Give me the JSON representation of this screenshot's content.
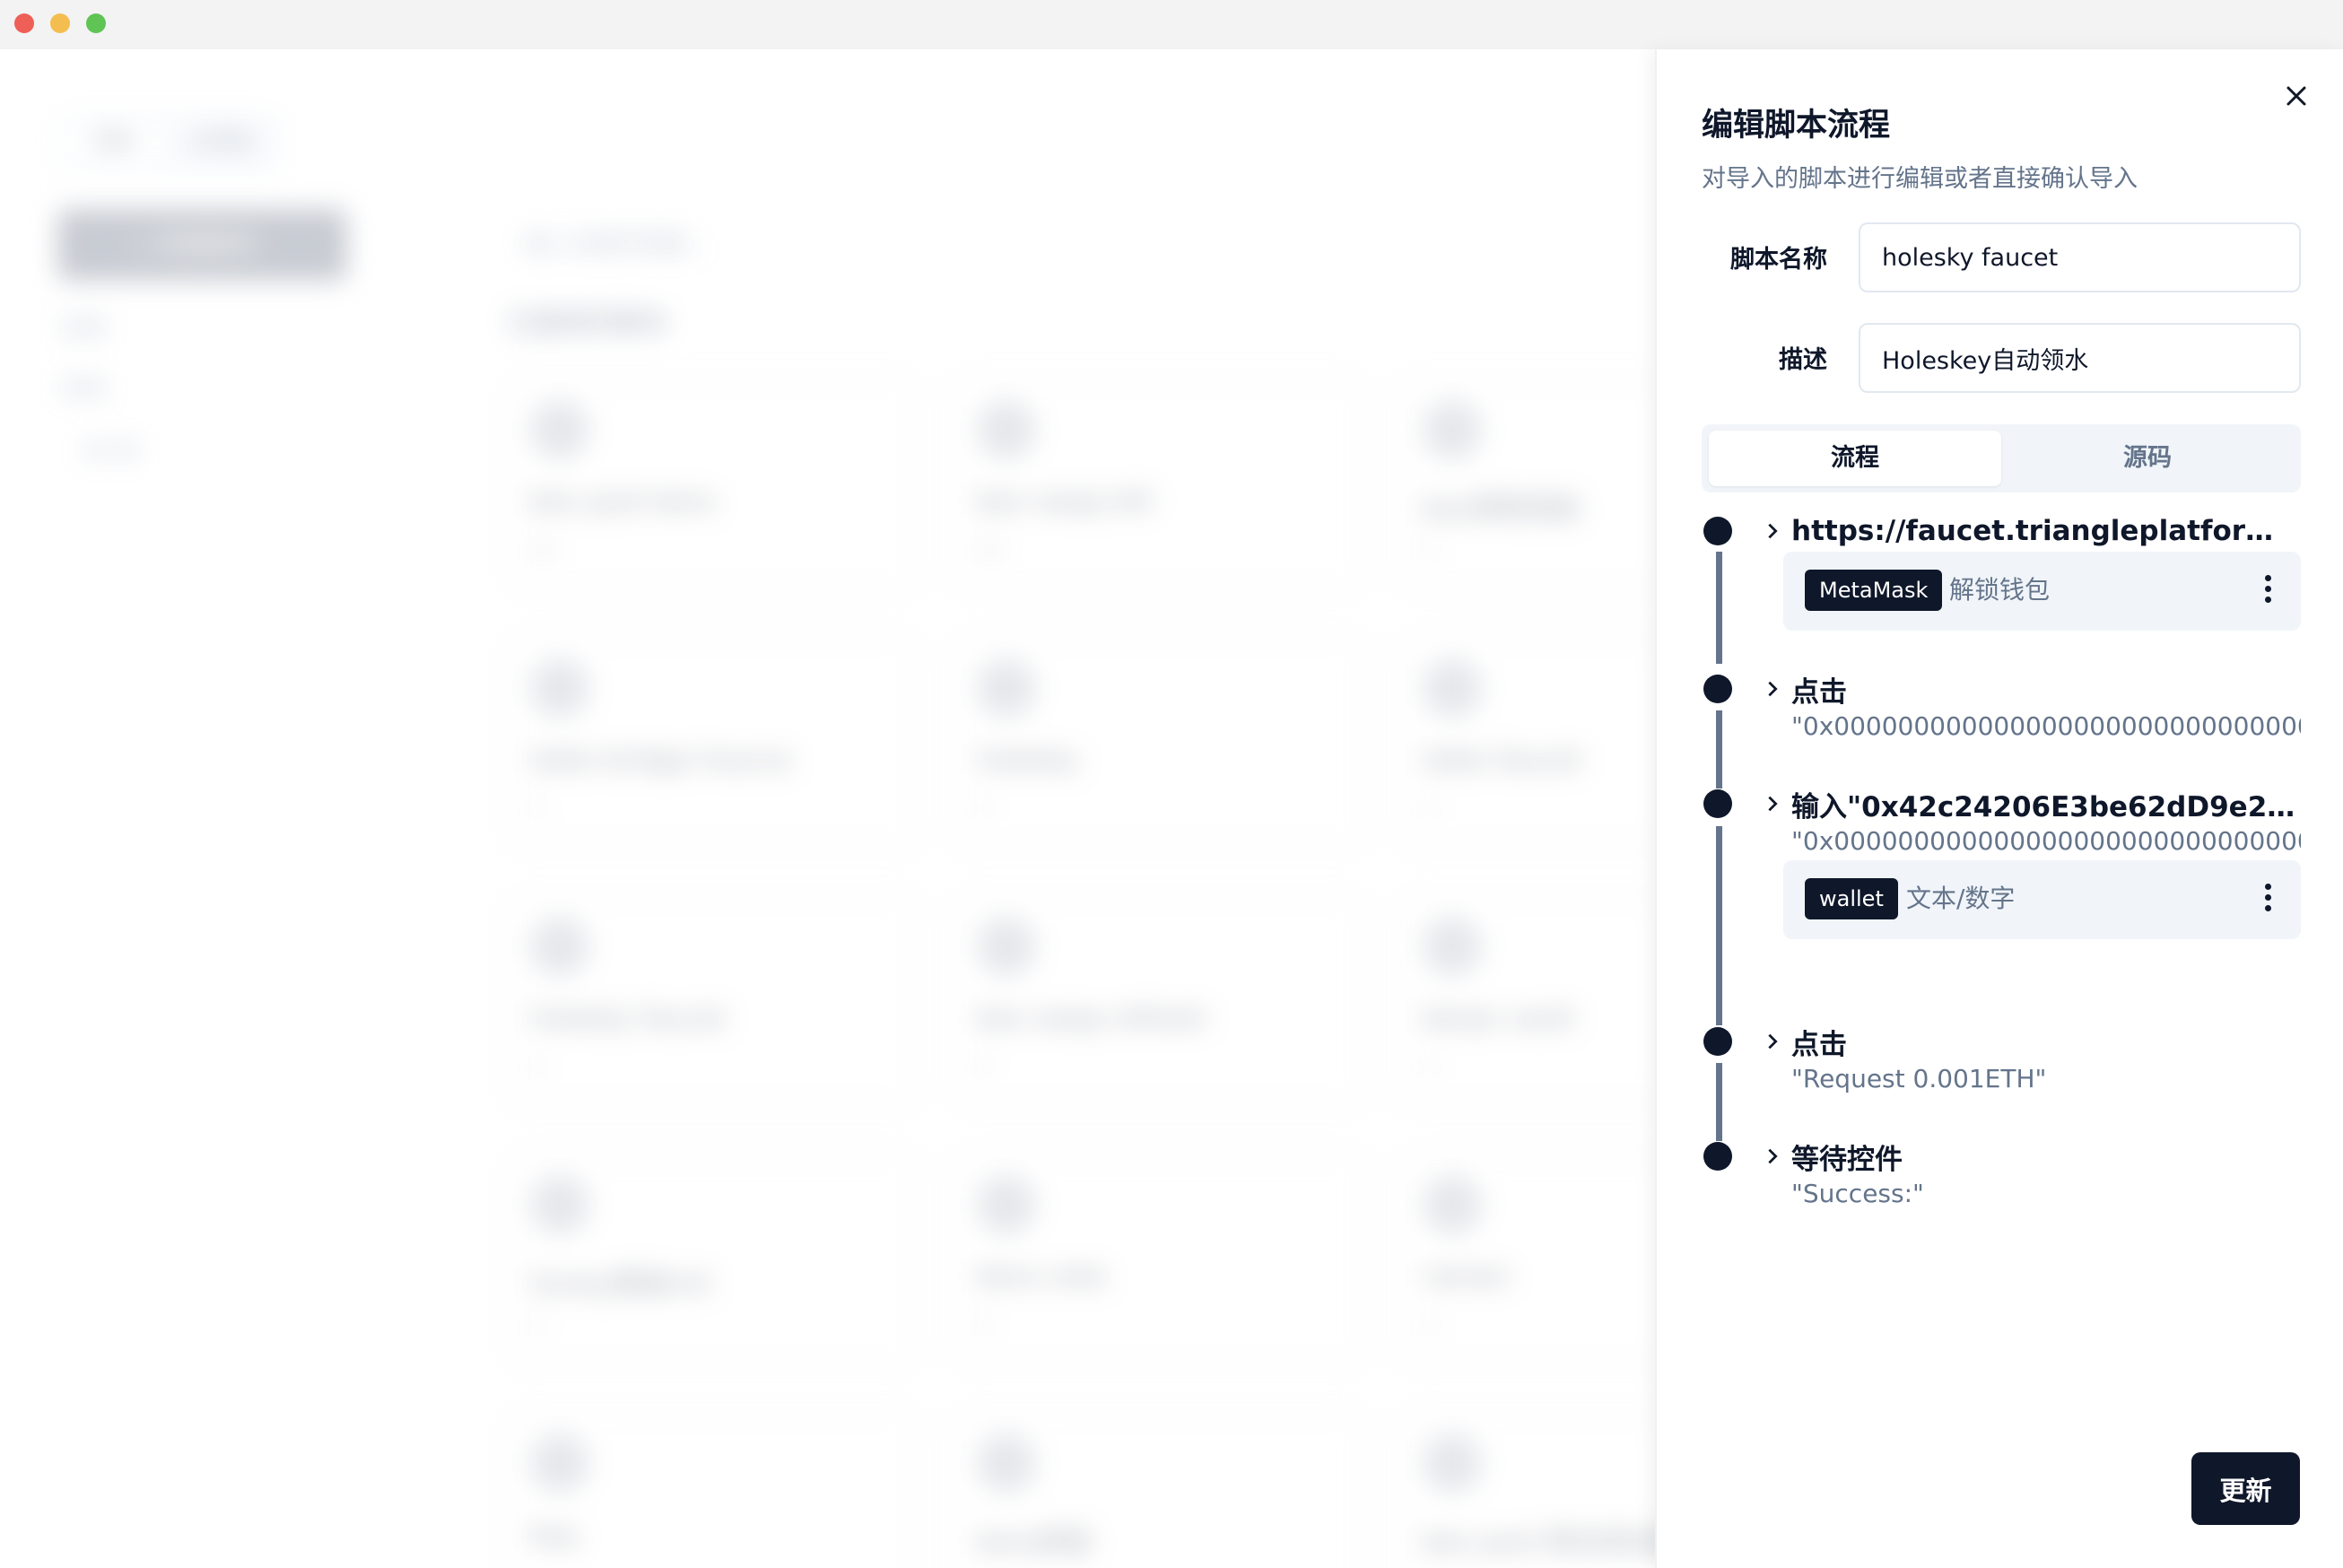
{
  "background_app": {
    "tabs": [
      "脚本",
      "工作流"
    ],
    "new_script_button": "+ 新建脚本",
    "sidebar_items": [
      "全部",
      "本地",
      "未分类"
    ],
    "search_placeholder": "输入关键字搜索...",
    "section_title": "已复制的脚本",
    "cards": [
      {
        "name": "bex pool bera",
        "count": "12"
      },
      {
        "name": "bex swap bill",
        "count": "12"
      },
      {
        "name": "bex获取奖励",
        "count": "1"
      },
      {
        "name": "taiko bridge hource",
        "count": "1"
      },
      {
        "name": "holesky",
        "count": "1"
      },
      {
        "name": "taiko faucet",
        "count": "1"
      },
      {
        "name": "holesky faucet",
        "count": "1"
      },
      {
        "name": "bex swap refresh",
        "count": "1"
      },
      {
        "name": "berps vault",
        "count": "1"
      },
      {
        "name": "honey铸造mit",
        "count": "1"
      },
      {
        "name": "bera vote",
        "count": "1"
      },
      {
        "name": "ramen",
        "count": "1"
      },
      {
        "name": "bay",
        "count": ""
      },
      {
        "name": "bera奖励",
        "count": ""
      },
      {
        "name": "bex pool 移动流动性",
        "count": ""
      }
    ]
  },
  "drawer": {
    "title": "编辑脚本流程",
    "subtitle": "对导入的脚本进行编辑或者直接确认导入",
    "fields": {
      "name_label": "脚本名称",
      "name_value": "holesky faucet",
      "desc_label": "描述",
      "desc_value": "Holeskey自动领水"
    },
    "tabs": {
      "flow": "流程",
      "source": "源码"
    },
    "steps": [
      {
        "title": "https://faucet.triangleplatform.com/e...",
        "subtitle": "",
        "var_chip": "MetaMask",
        "var_text": "解锁钱包"
      },
      {
        "title": "点击",
        "subtitle": "\"0x0000000000000000000000000000000000",
        "var_chip": "",
        "var_text": ""
      },
      {
        "title": "输入\"0x42c24206E3be62dD9e233e...",
        "subtitle": "\"0x0000000000000000000000000000000000",
        "var_chip": "wallet",
        "var_text": "文本/数字"
      },
      {
        "title": "点击",
        "subtitle": "\"Request 0.001ETH\"",
        "var_chip": "",
        "var_text": ""
      },
      {
        "title": "等待控件",
        "subtitle": "\"Success:\"",
        "var_chip": "",
        "var_text": ""
      }
    ],
    "update_button": "更新"
  },
  "colors": {
    "primary": "#0f172a",
    "muted_text": "#64748b",
    "muted_bg": "#f1f5f9",
    "border": "#e2e8f0"
  }
}
